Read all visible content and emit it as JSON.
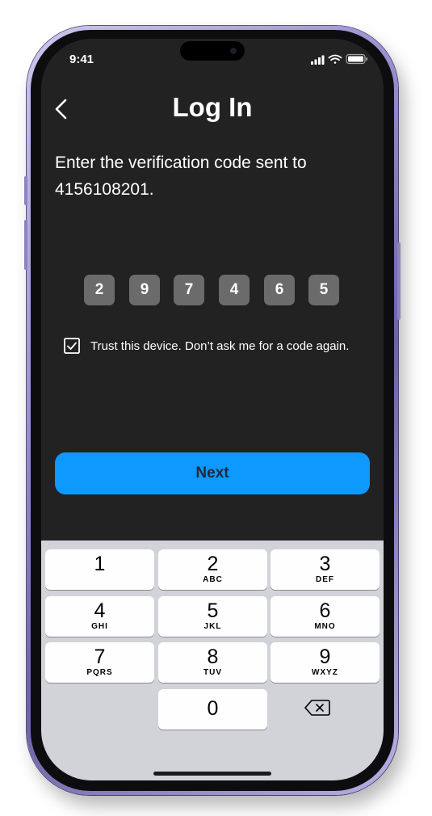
{
  "status_bar": {
    "time": "9:41"
  },
  "header": {
    "title": "Log In",
    "back_icon": "chevron-left-icon"
  },
  "instruction": "Enter the verification code sent to 4156108201.",
  "code_digits": [
    "2",
    "9",
    "7",
    "4",
    "6",
    "5"
  ],
  "trust": {
    "checked": true,
    "label": "Trust this device. Don’t ask me for a code again."
  },
  "next_button": {
    "label": "Next",
    "color": "#0d99ff"
  },
  "keypad": [
    {
      "digit": "1",
      "letters": ""
    },
    {
      "digit": "2",
      "letters": "ABC"
    },
    {
      "digit": "3",
      "letters": "DEF"
    },
    {
      "digit": "4",
      "letters": "GHI"
    },
    {
      "digit": "5",
      "letters": "JKL"
    },
    {
      "digit": "6",
      "letters": "MNO"
    },
    {
      "digit": "7",
      "letters": "PQRS"
    },
    {
      "digit": "8",
      "letters": "TUV"
    },
    {
      "digit": "9",
      "letters": "WXYZ"
    },
    {
      "digit": "0",
      "letters": ""
    }
  ],
  "colors": {
    "screen_bg": "#222222",
    "code_box": "#6b6b6b",
    "keyboard_bg": "#d1d3d9"
  }
}
